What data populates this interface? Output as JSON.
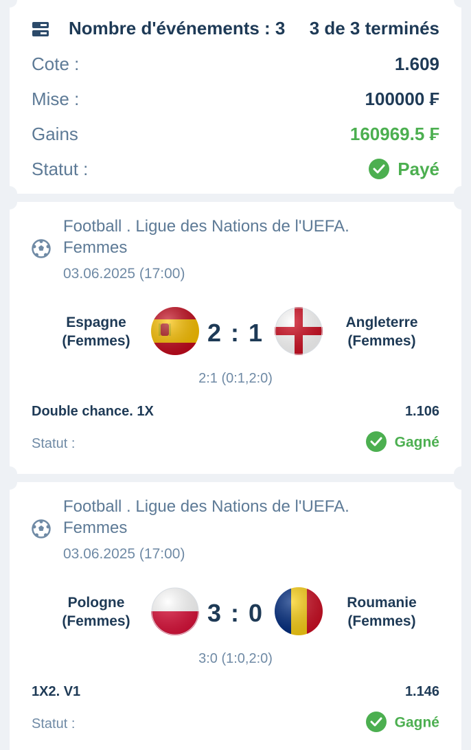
{
  "summary": {
    "events_label": "Nombre d'événements : 3",
    "events_done": "3 de 3 terminés",
    "odds_label": "Cote :",
    "odds_value": "1.609",
    "stake_label": "Mise :",
    "stake_value": "100000 ₣",
    "winnings_label": "Gains",
    "winnings_value": "160969.5 ₣",
    "status_label": "Statut :",
    "status_value": "Payé"
  },
  "events": [
    {
      "competition_line1": "Football . Ligue des Nations de l'UEFA.",
      "competition_line2": "Femmes",
      "date": "03.06.2025 (17:00)",
      "home_line1": "Espagne",
      "home_line2": "(Femmes)",
      "away_line1": "Angleterre",
      "away_line2": "(Femmes)",
      "score": "2 : 1",
      "score_detail": "2:1 (0:1,2:0)",
      "market": "Double chance. 1X",
      "odds": "1.106",
      "status_label": "Statut :",
      "status_value": "Gagné"
    },
    {
      "competition_line1": "Football . Ligue des Nations de l'UEFA.",
      "competition_line2": "Femmes",
      "date": "03.06.2025 (17:00)",
      "home_line1": "Pologne",
      "home_line2": "(Femmes)",
      "away_line1": "Roumanie",
      "away_line2": "(Femmes)",
      "score": "3 : 0",
      "score_detail": "3:0 (1:0,2:0)",
      "market": "1X2. V1",
      "odds": "1.146",
      "status_label": "Statut :",
      "status_value": "Gagné"
    }
  ],
  "icons": {
    "events": "list-icon",
    "sport": "soccer-ball-icon",
    "status": "check-circle-icon"
  },
  "colors": {
    "accent_green": "#4caf50",
    "text_dark": "#1e3a56",
    "text_muted": "#5d7a96"
  }
}
